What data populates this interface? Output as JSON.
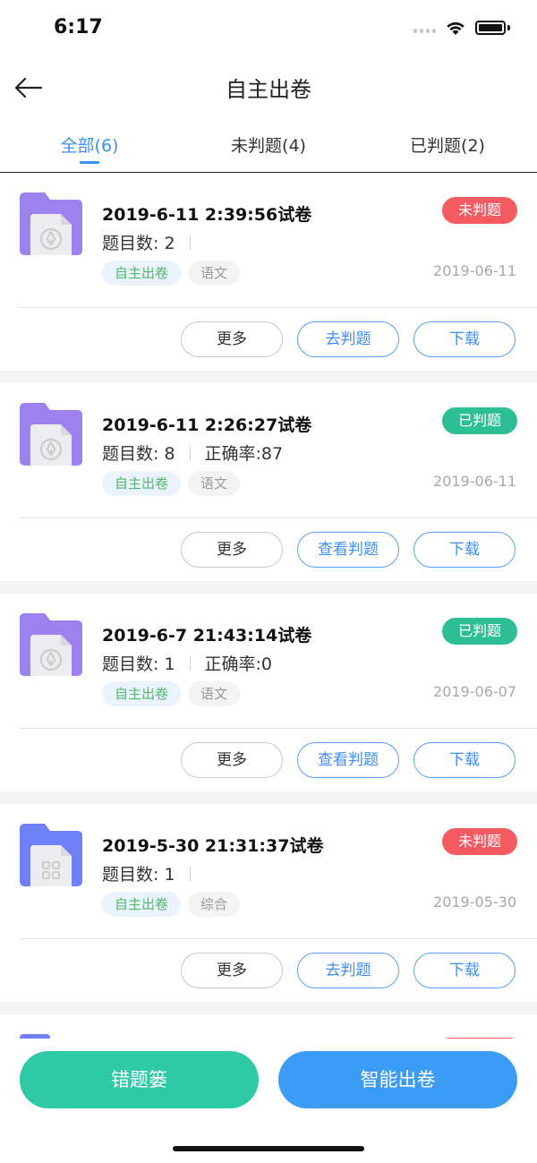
{
  "status_bar": {
    "time": "6:17"
  },
  "nav": {
    "title": "自主出卷"
  },
  "tabs": [
    {
      "label": "全部(6)",
      "active": true
    },
    {
      "label": "未判题(4)",
      "active": false
    },
    {
      "label": "已判题(2)",
      "active": false
    }
  ],
  "cards": [
    {
      "title": "2019-6-11 2:39:56试卷",
      "status": "未判题",
      "status_kind": "todo",
      "count": "题目数: 2",
      "accuracy": "",
      "tag_mode": "自主出卷",
      "tag_subject": "语文",
      "date": "2019-06-11",
      "icon": "pen-document-icon",
      "folder_color": "#9b82ee",
      "btn_more": "更多",
      "btn_action": "去判题",
      "btn_download": "下载"
    },
    {
      "title": "2019-6-11 2:26:27试卷",
      "status": "已判题",
      "status_kind": "done",
      "count": "题目数: 8",
      "accuracy": "正确率:87",
      "tag_mode": "自主出卷",
      "tag_subject": "语文",
      "date": "2019-06-11",
      "icon": "pen-document-icon",
      "folder_color": "#9b82ee",
      "btn_more": "更多",
      "btn_action": "查看判题",
      "btn_download": "下载"
    },
    {
      "title": "2019-6-7 21:43:14试卷",
      "status": "已判题",
      "status_kind": "done",
      "count": "题目数: 1",
      "accuracy": "正确率:0",
      "tag_mode": "自主出卷",
      "tag_subject": "语文",
      "date": "2019-06-07",
      "icon": "pen-document-icon",
      "folder_color": "#9b82ee",
      "btn_more": "更多",
      "btn_action": "查看判题",
      "btn_download": "下载"
    },
    {
      "title": "2019-5-30 21:31:37试卷",
      "status": "未判题",
      "status_kind": "todo",
      "count": "题目数: 1",
      "accuracy": "",
      "tag_mode": "自主出卷",
      "tag_subject": "综合",
      "date": "2019-05-30",
      "icon": "grid-document-icon",
      "folder_color": "#6f7ff5",
      "btn_more": "更多",
      "btn_action": "去判题",
      "btn_download": "下载"
    }
  ],
  "bottom": {
    "wrong_book": "错题篓",
    "smart_paper": "智能出卷"
  },
  "colors": {
    "accent": "#3b8ff5",
    "todo": "#f65a61",
    "done": "#2dbf94",
    "green": "#2ecaa5",
    "blue": "#3b9cf6"
  }
}
